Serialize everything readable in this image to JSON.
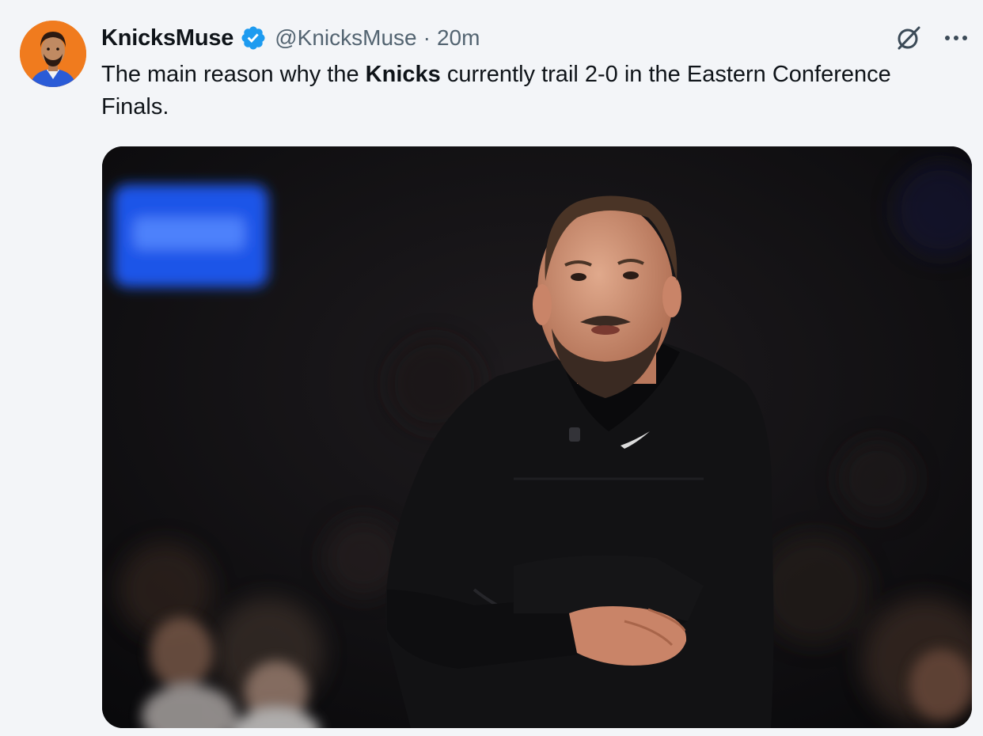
{
  "tweet": {
    "display_name": "KnicksMuse",
    "handle": "@KnicksMuse",
    "separator": "·",
    "time": "20m",
    "text_before": "The main reason why the ",
    "text_bold": "Knicks",
    "text_after": " currently trail 2-0 in the Eastern Conference Finals.",
    "verified": true
  },
  "icons": {
    "avatar": "profile-avatar",
    "verified": "verified-badge-icon",
    "grok": "grok-icon",
    "more": "more-options-icon"
  },
  "colors": {
    "background": "#f3f5f8",
    "verified_blue": "#1d9bf0",
    "secondary_text": "#536471",
    "avatar_bg": "#f07b1e"
  }
}
